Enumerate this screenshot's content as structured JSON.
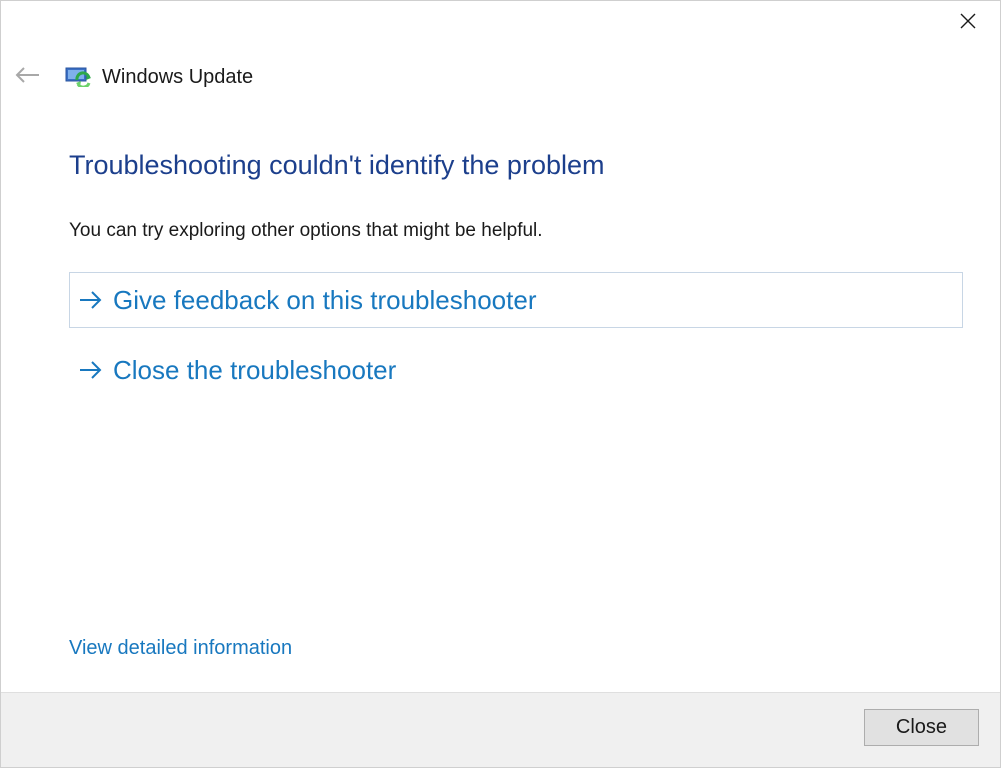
{
  "window": {
    "title": "Windows Update",
    "app_icon": "windows-update-icon",
    "back_icon": "back-arrow-icon",
    "close_icon": "close-icon"
  },
  "main": {
    "heading": "Troubleshooting couldn't identify the problem",
    "subtext": "You can try exploring other options that might be helpful.",
    "options": [
      {
        "label": "Give feedback on this troubleshooter",
        "icon": "right-arrow-icon",
        "focused": true
      },
      {
        "label": "Close the troubleshooter",
        "icon": "right-arrow-icon",
        "focused": false
      }
    ],
    "details_link": "View detailed information"
  },
  "footer": {
    "close_label": "Close"
  },
  "colors": {
    "heading": "#1c3f8c",
    "link": "#1878bf",
    "footer_bg": "#f0f0f0",
    "button_bg": "#e1e1e1"
  }
}
